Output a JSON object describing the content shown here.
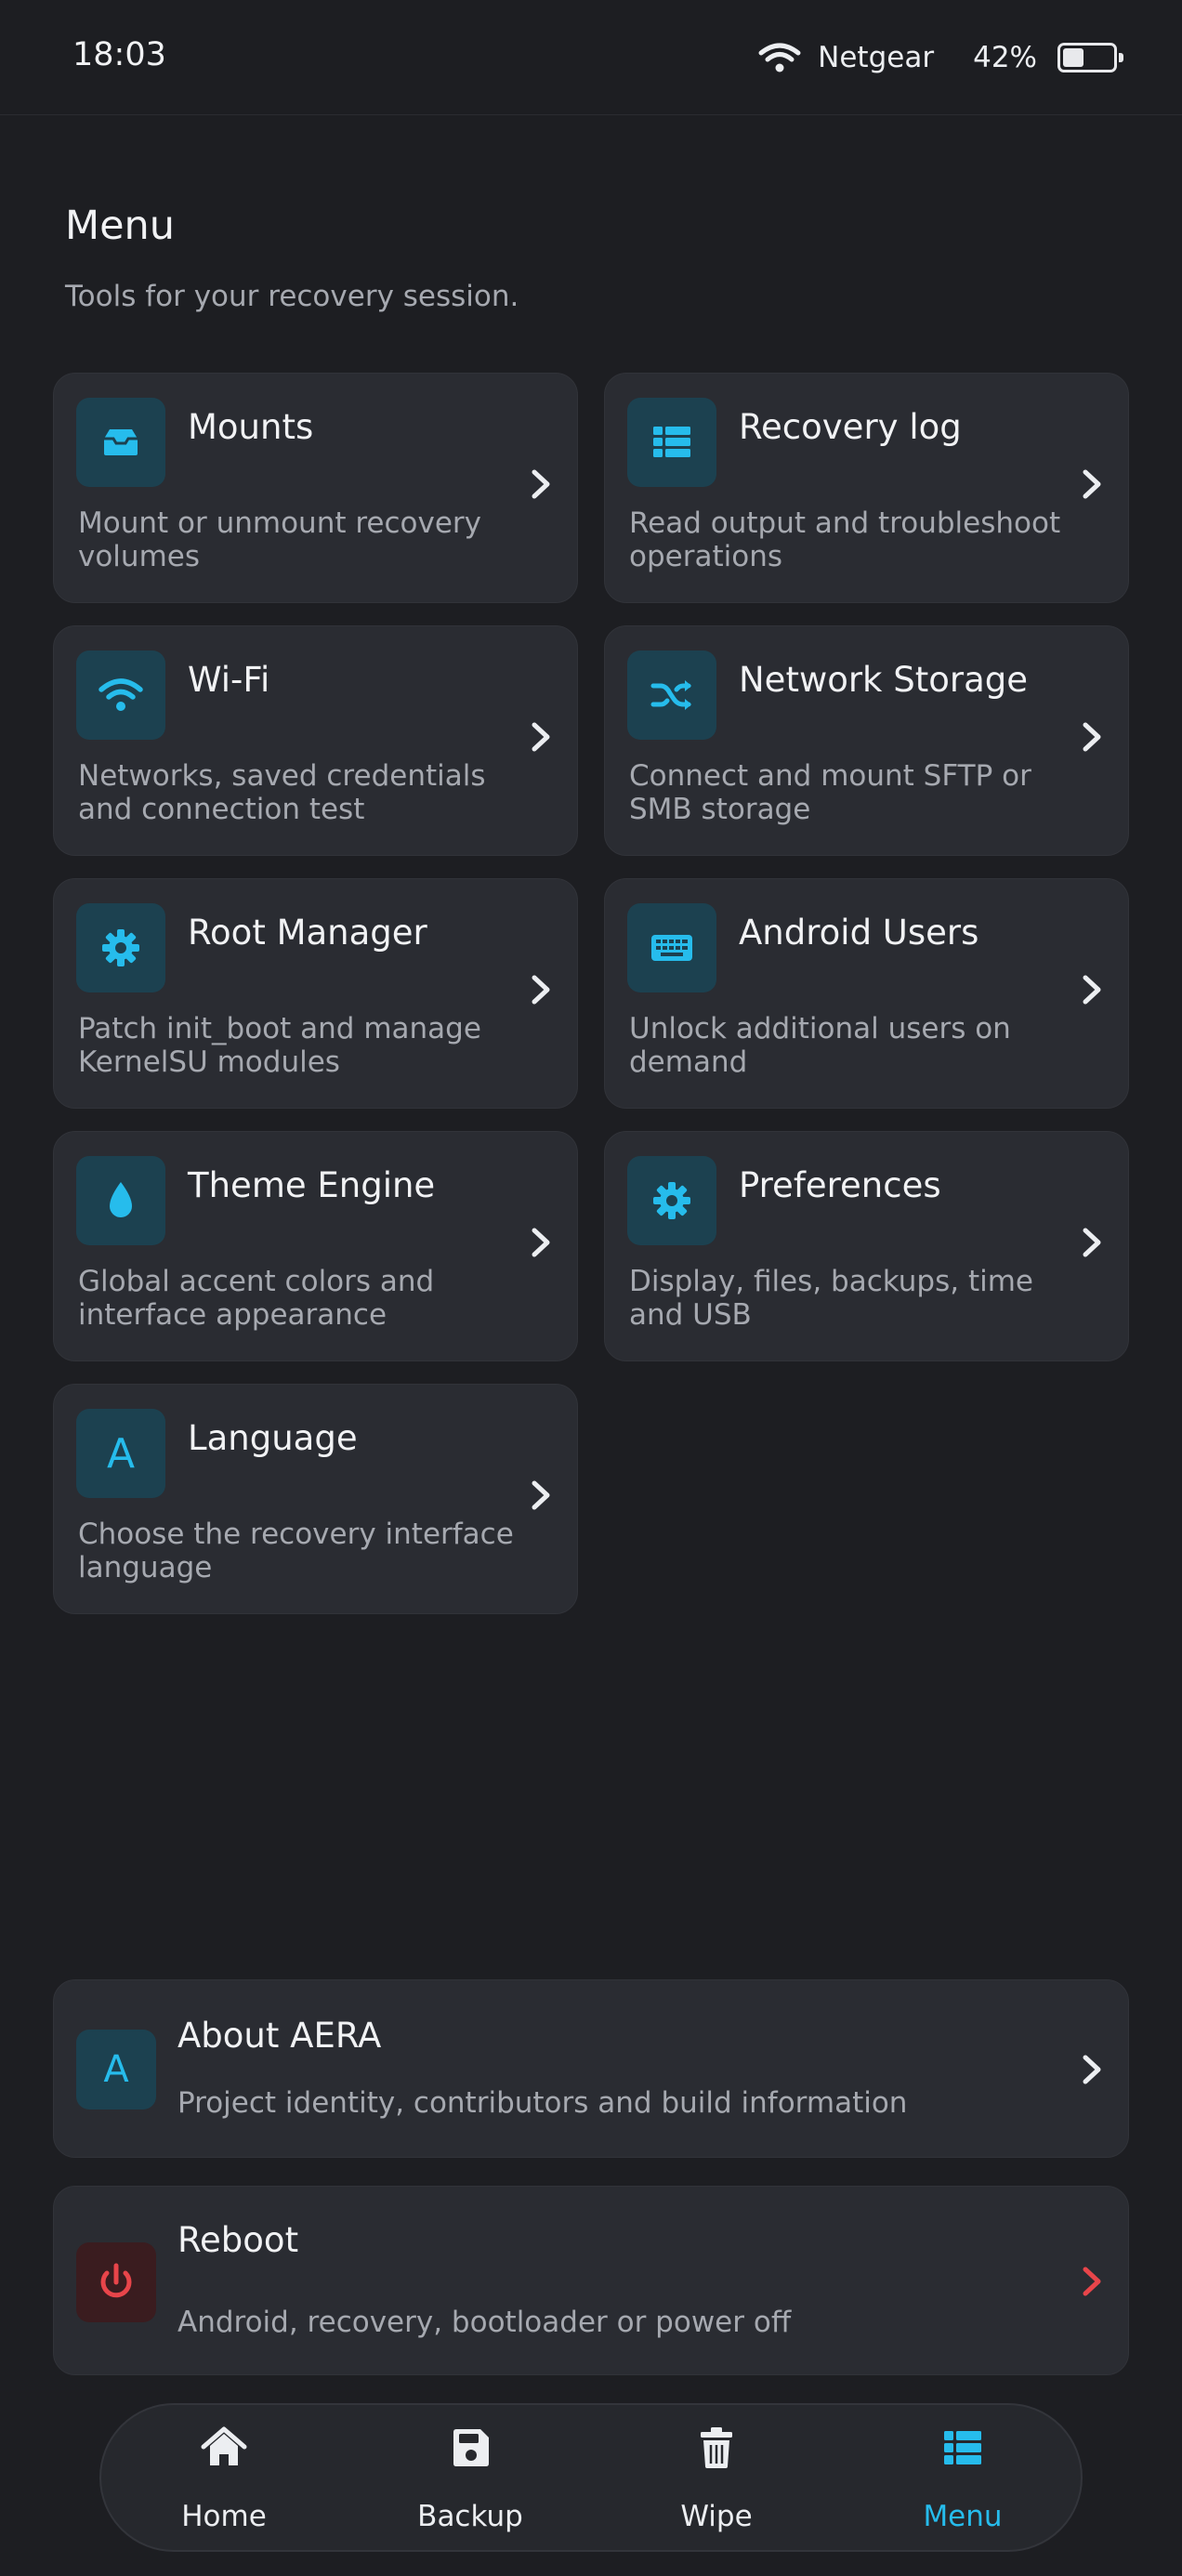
{
  "status_bar": {
    "time": "18:03",
    "network": "Netgear",
    "battery": "42%",
    "battery_level": 0.42
  },
  "header": {
    "title": "Menu",
    "subtitle": "Tools for your recovery session."
  },
  "menu_items": [
    {
      "title": "Mounts",
      "description": "Mount or unmount recovery volumes",
      "icon": "inbox-tray-icon"
    },
    {
      "title": "Recovery log",
      "description": "Read output and troubleshoot operations",
      "icon": "list-icon"
    },
    {
      "title": "Wi-Fi",
      "description": "Networks, saved credentials and connection test",
      "icon": "wifi-icon"
    },
    {
      "title": "Network Storage",
      "description": "Connect and mount SFTP or SMB storage",
      "icon": "shuffle-icon"
    },
    {
      "title": "Root Manager",
      "description": "Patch init_boot and manage KernelSU modules",
      "icon": "gear-icon"
    },
    {
      "title": "Android Users",
      "description": "Unlock additional users on demand",
      "icon": "keyboard-icon"
    },
    {
      "title": "Theme Engine",
      "description": "Global accent colors and interface appearance",
      "icon": "droplet-icon"
    },
    {
      "title": "Preferences",
      "description": "Display, files, backups, time and USB",
      "icon": "gear-icon"
    },
    {
      "title": "Language",
      "description": "Choose the recovery interface language",
      "icon": "letter-a-icon",
      "icon_letter": "A"
    }
  ],
  "about": {
    "title": "About AERA",
    "description": "Project identity, contributors and build information",
    "icon_letter": "A"
  },
  "reboot": {
    "title": "Reboot",
    "description": "Android, recovery, bootloader or power off",
    "icon": "power-icon"
  },
  "bottom_nav": [
    {
      "label": "Home",
      "icon": "home-icon",
      "active": false
    },
    {
      "label": "Backup",
      "icon": "save-icon",
      "active": false
    },
    {
      "label": "Wipe",
      "icon": "trash-icon",
      "active": false
    },
    {
      "label": "Menu",
      "icon": "list-icon",
      "active": true
    }
  ],
  "colors": {
    "background": "#1d1e22",
    "card": "#2a2c32",
    "accent": "#26bcec",
    "icon_tile": "#1c4150",
    "danger": "#e8454a",
    "danger_tile": "#3a1c1f",
    "text_secondary": "#a6a9b0"
  }
}
